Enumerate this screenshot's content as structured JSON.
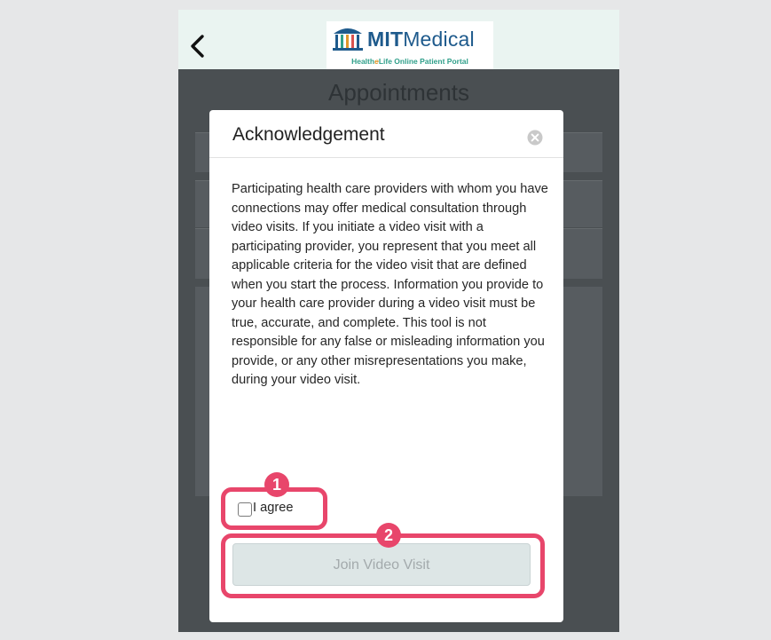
{
  "header": {
    "logo": {
      "name": "MITMedical",
      "name_bold": "MIT",
      "name_regular": "Medical",
      "subtitle_part1": "Health",
      "subtitle_accent": "e",
      "subtitle_part2": "Life Online Patient Portal"
    }
  },
  "background": {
    "page_title": "Appointments"
  },
  "modal": {
    "title": "Acknowledgement",
    "body": "Participating health care providers with whom you have connections may offer medical consultation through video visits. If you initiate a video visit with a participating provider, you represent that you meet all applicable criteria for the video visit that are defined when you start the process. Information you provide to your health care provider during a video visit must be true, accurate, and complete. This tool is not responsible for any false or misleading information you provide, or any other misrepresentations you make, during your video visit.",
    "agree_label": "I agree",
    "agree_checked": false,
    "join_button_label": "Join Video Visit",
    "join_button_enabled": false
  },
  "annotations": [
    {
      "number": "1",
      "target": "agree-checkbox"
    },
    {
      "number": "2",
      "target": "join-video-visit-button"
    }
  ],
  "colors": {
    "annotation": "#e8466b",
    "overlay": "#4a4f52",
    "header_bg": "#eaf4f1",
    "brand_blue": "#1e5a8c",
    "brand_teal": "#2f9f8a"
  },
  "icons": {
    "back": "chevron-left-icon",
    "close": "close-circle-icon",
    "logo": "building-columns-icon"
  }
}
